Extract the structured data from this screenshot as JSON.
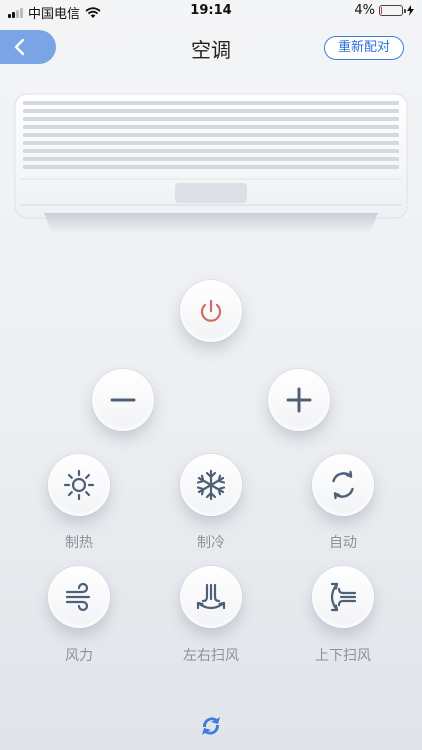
{
  "status": {
    "carrier": "中国电信",
    "time": "19:14",
    "battery": "4%",
    "battery_level": 0.04
  },
  "header": {
    "title": "空调",
    "pair_label": "重新配对"
  },
  "controls": {
    "power": "power-icon",
    "minus": "minus-icon",
    "plus": "plus-icon",
    "heat_label": "制热",
    "cool_label": "制冷",
    "auto_label": "自动",
    "fan_label": "风力",
    "swing_lr_label": "左右扫风",
    "swing_ud_label": "上下扫风"
  },
  "colors": {
    "accent": "#3f7be0",
    "back": "#7aa4e6",
    "power": "#d46b62",
    "icon": "#4f5f76"
  }
}
